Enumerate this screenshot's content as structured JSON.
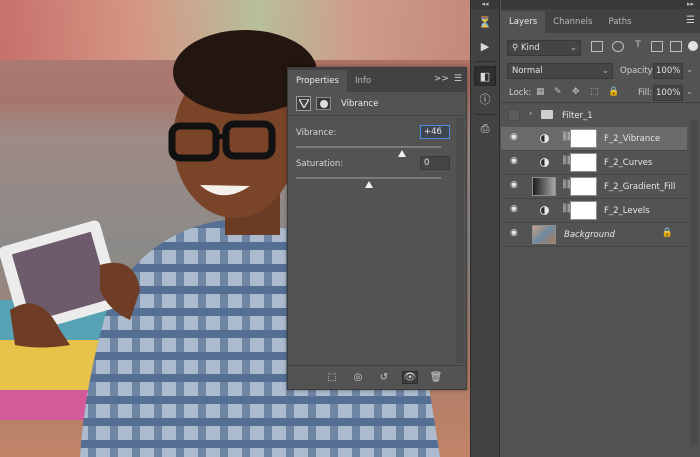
{
  "properties": {
    "tabs": [
      {
        "label": "Properties"
      },
      {
        "label": "Info"
      }
    ],
    "collapse_label": ">>",
    "title": "Vibrance",
    "vibrance": {
      "label": "Vibrance:",
      "value": "+46",
      "level_percent": 73
    },
    "saturation": {
      "label": "Saturation:",
      "value": "0",
      "level_percent": 50
    },
    "footer_icons": [
      "clip-to-layer-icon",
      "view-previous-icon",
      "reset-icon",
      "visibility-icon",
      "trash-icon"
    ]
  },
  "toolstrip": {
    "collapse_label": "◂◂",
    "icons": [
      "history-icon",
      "play-icon",
      "adjustments-icon",
      "info-icon",
      "clone-source-icon"
    ]
  },
  "layers_panel": {
    "collapse_label": "▸▸",
    "tabs": [
      {
        "label": "Layers"
      },
      {
        "label": "Channels"
      },
      {
        "label": "Paths"
      }
    ],
    "filter": {
      "label": "Kind"
    },
    "blend_mode": "Normal",
    "opacity": {
      "label": "Opacity:",
      "value": "100%"
    },
    "lock_label": "Lock:",
    "fill": {
      "label": "Fill:",
      "value": "100%"
    },
    "layers": [
      {
        "name": "Filter_1",
        "type": "group"
      },
      {
        "name": "F_2_Vibrance",
        "type": "adjustment",
        "selected": true
      },
      {
        "name": "F_2_Curves",
        "type": "adjustment"
      },
      {
        "name": "F_2_Gradient_Fill",
        "type": "gradient"
      },
      {
        "name": "F_2_Levels",
        "type": "adjustment"
      },
      {
        "name": "Background",
        "type": "image",
        "locked": true
      }
    ]
  },
  "colors": {
    "panel": "#535353",
    "dark": "#424242",
    "selected_layer": "#6a6a6a",
    "focus": "#4d8ee0"
  }
}
